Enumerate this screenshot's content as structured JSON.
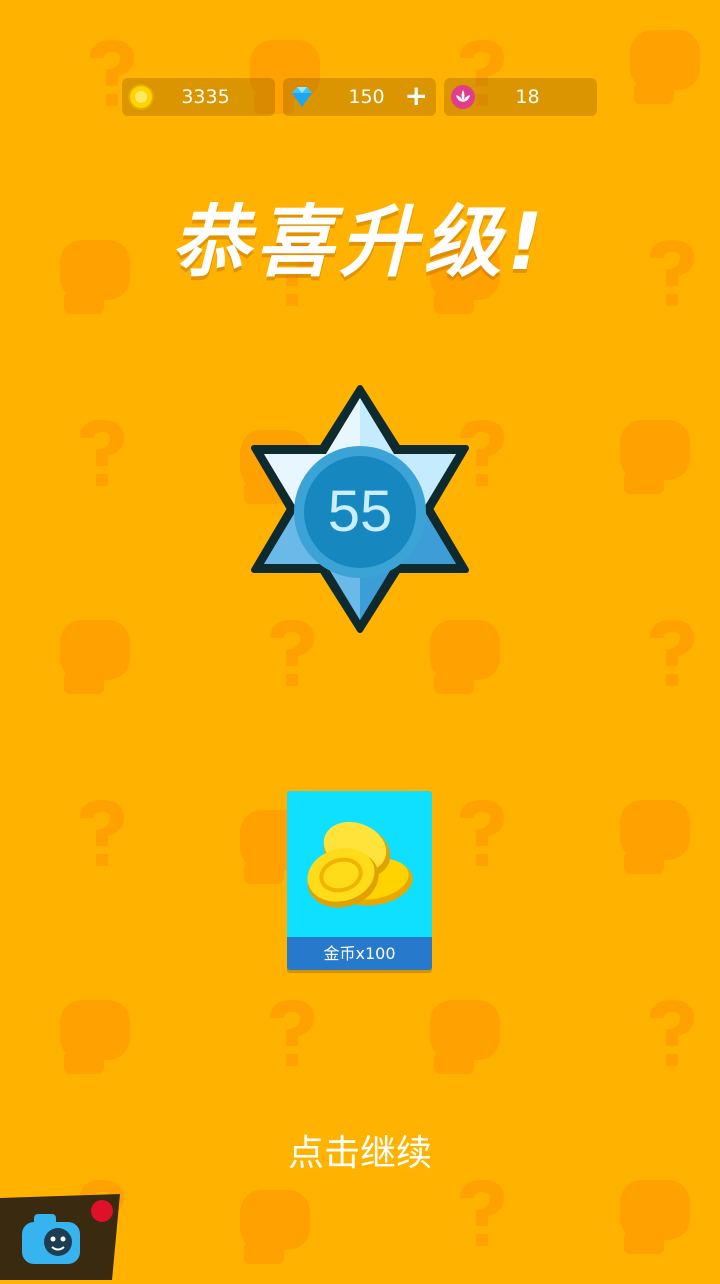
{
  "resources": {
    "coins": {
      "value": "3335",
      "icon": "coin-icon"
    },
    "diamonds": {
      "value": "150",
      "icon": "diamond-icon",
      "plus": "+"
    },
    "lotus": {
      "value": "18",
      "icon": "lotus-icon"
    }
  },
  "title": "恭喜升级!",
  "level": {
    "value": "55",
    "icon": "level-star-badge-icon"
  },
  "reward": {
    "label": "金币x100",
    "icon": "gold-coins-icon"
  },
  "continue_text": "点击继续",
  "corner_button": {
    "icon": "camera-mascot-icon",
    "notification": true
  },
  "colors": {
    "background": "#FFB300",
    "reward_bg": "#0FE0FF",
    "reward_label_bg": "#2679CB",
    "badge_blue": "#7FC8F2"
  }
}
